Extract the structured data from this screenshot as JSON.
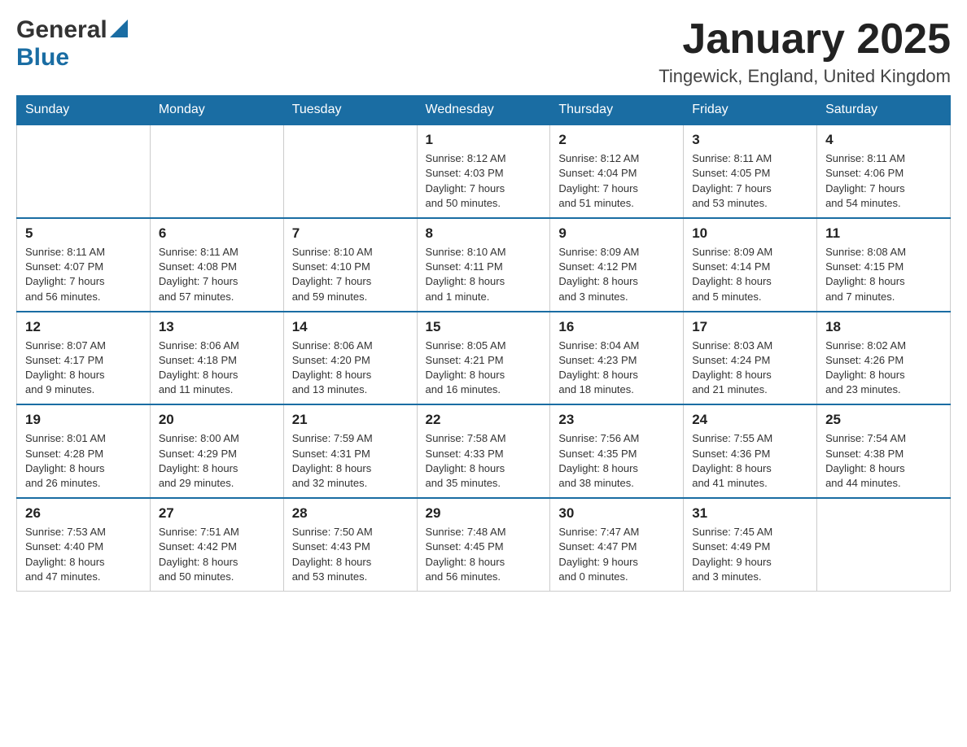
{
  "header": {
    "logo_general": "General",
    "logo_blue": "Blue",
    "month_title": "January 2025",
    "location": "Tingewick, England, United Kingdom"
  },
  "weekdays": [
    "Sunday",
    "Monday",
    "Tuesday",
    "Wednesday",
    "Thursday",
    "Friday",
    "Saturday"
  ],
  "weeks": [
    [
      {
        "day": "",
        "info": ""
      },
      {
        "day": "",
        "info": ""
      },
      {
        "day": "",
        "info": ""
      },
      {
        "day": "1",
        "info": "Sunrise: 8:12 AM\nSunset: 4:03 PM\nDaylight: 7 hours\nand 50 minutes."
      },
      {
        "day": "2",
        "info": "Sunrise: 8:12 AM\nSunset: 4:04 PM\nDaylight: 7 hours\nand 51 minutes."
      },
      {
        "day": "3",
        "info": "Sunrise: 8:11 AM\nSunset: 4:05 PM\nDaylight: 7 hours\nand 53 minutes."
      },
      {
        "day": "4",
        "info": "Sunrise: 8:11 AM\nSunset: 4:06 PM\nDaylight: 7 hours\nand 54 minutes."
      }
    ],
    [
      {
        "day": "5",
        "info": "Sunrise: 8:11 AM\nSunset: 4:07 PM\nDaylight: 7 hours\nand 56 minutes."
      },
      {
        "day": "6",
        "info": "Sunrise: 8:11 AM\nSunset: 4:08 PM\nDaylight: 7 hours\nand 57 minutes."
      },
      {
        "day": "7",
        "info": "Sunrise: 8:10 AM\nSunset: 4:10 PM\nDaylight: 7 hours\nand 59 minutes."
      },
      {
        "day": "8",
        "info": "Sunrise: 8:10 AM\nSunset: 4:11 PM\nDaylight: 8 hours\nand 1 minute."
      },
      {
        "day": "9",
        "info": "Sunrise: 8:09 AM\nSunset: 4:12 PM\nDaylight: 8 hours\nand 3 minutes."
      },
      {
        "day": "10",
        "info": "Sunrise: 8:09 AM\nSunset: 4:14 PM\nDaylight: 8 hours\nand 5 minutes."
      },
      {
        "day": "11",
        "info": "Sunrise: 8:08 AM\nSunset: 4:15 PM\nDaylight: 8 hours\nand 7 minutes."
      }
    ],
    [
      {
        "day": "12",
        "info": "Sunrise: 8:07 AM\nSunset: 4:17 PM\nDaylight: 8 hours\nand 9 minutes."
      },
      {
        "day": "13",
        "info": "Sunrise: 8:06 AM\nSunset: 4:18 PM\nDaylight: 8 hours\nand 11 minutes."
      },
      {
        "day": "14",
        "info": "Sunrise: 8:06 AM\nSunset: 4:20 PM\nDaylight: 8 hours\nand 13 minutes."
      },
      {
        "day": "15",
        "info": "Sunrise: 8:05 AM\nSunset: 4:21 PM\nDaylight: 8 hours\nand 16 minutes."
      },
      {
        "day": "16",
        "info": "Sunrise: 8:04 AM\nSunset: 4:23 PM\nDaylight: 8 hours\nand 18 minutes."
      },
      {
        "day": "17",
        "info": "Sunrise: 8:03 AM\nSunset: 4:24 PM\nDaylight: 8 hours\nand 21 minutes."
      },
      {
        "day": "18",
        "info": "Sunrise: 8:02 AM\nSunset: 4:26 PM\nDaylight: 8 hours\nand 23 minutes."
      }
    ],
    [
      {
        "day": "19",
        "info": "Sunrise: 8:01 AM\nSunset: 4:28 PM\nDaylight: 8 hours\nand 26 minutes."
      },
      {
        "day": "20",
        "info": "Sunrise: 8:00 AM\nSunset: 4:29 PM\nDaylight: 8 hours\nand 29 minutes."
      },
      {
        "day": "21",
        "info": "Sunrise: 7:59 AM\nSunset: 4:31 PM\nDaylight: 8 hours\nand 32 minutes."
      },
      {
        "day": "22",
        "info": "Sunrise: 7:58 AM\nSunset: 4:33 PM\nDaylight: 8 hours\nand 35 minutes."
      },
      {
        "day": "23",
        "info": "Sunrise: 7:56 AM\nSunset: 4:35 PM\nDaylight: 8 hours\nand 38 minutes."
      },
      {
        "day": "24",
        "info": "Sunrise: 7:55 AM\nSunset: 4:36 PM\nDaylight: 8 hours\nand 41 minutes."
      },
      {
        "day": "25",
        "info": "Sunrise: 7:54 AM\nSunset: 4:38 PM\nDaylight: 8 hours\nand 44 minutes."
      }
    ],
    [
      {
        "day": "26",
        "info": "Sunrise: 7:53 AM\nSunset: 4:40 PM\nDaylight: 8 hours\nand 47 minutes."
      },
      {
        "day": "27",
        "info": "Sunrise: 7:51 AM\nSunset: 4:42 PM\nDaylight: 8 hours\nand 50 minutes."
      },
      {
        "day": "28",
        "info": "Sunrise: 7:50 AM\nSunset: 4:43 PM\nDaylight: 8 hours\nand 53 minutes."
      },
      {
        "day": "29",
        "info": "Sunrise: 7:48 AM\nSunset: 4:45 PM\nDaylight: 8 hours\nand 56 minutes."
      },
      {
        "day": "30",
        "info": "Sunrise: 7:47 AM\nSunset: 4:47 PM\nDaylight: 9 hours\nand 0 minutes."
      },
      {
        "day": "31",
        "info": "Sunrise: 7:45 AM\nSunset: 4:49 PM\nDaylight: 9 hours\nand 3 minutes."
      },
      {
        "day": "",
        "info": ""
      }
    ]
  ]
}
